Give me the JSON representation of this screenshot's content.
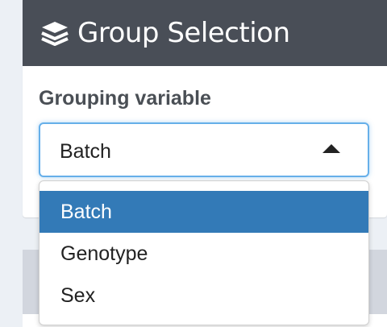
{
  "panel": {
    "icon": "layers-icon",
    "title": "Group Selection",
    "header_color": "#494e57"
  },
  "field": {
    "label": "Grouping variable",
    "selected_value": "Batch"
  },
  "dropdown": {
    "options": [
      "Batch",
      "Genotype",
      "Sex"
    ],
    "selected_index": 0,
    "highlight_color": "#337ab7"
  }
}
